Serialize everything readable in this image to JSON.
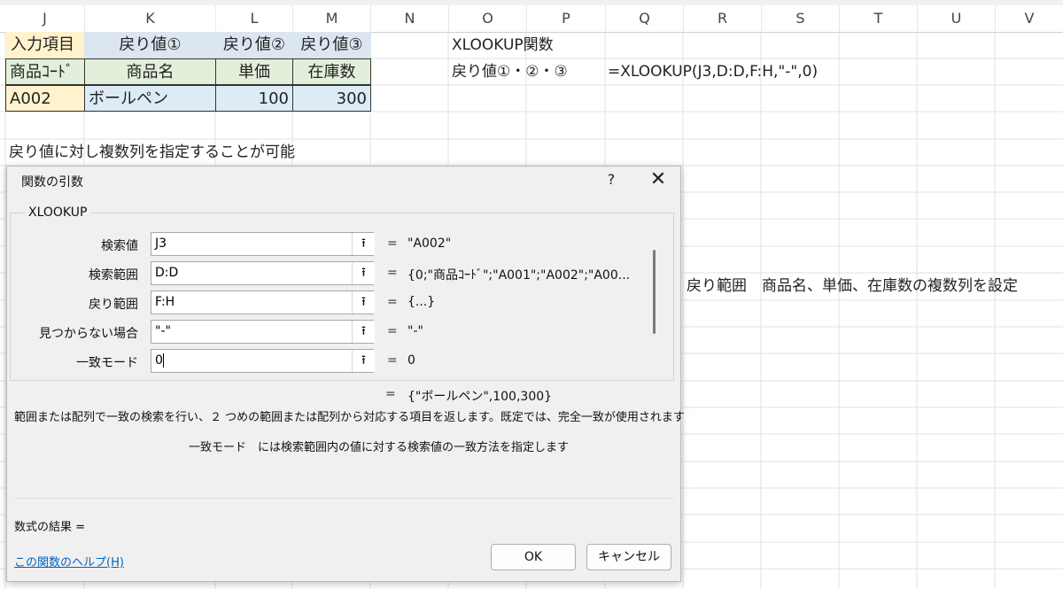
{
  "columns": [
    "J",
    "K",
    "L",
    "M",
    "N",
    "O",
    "P",
    "Q",
    "R",
    "S",
    "T",
    "U",
    "V"
  ],
  "table": {
    "row1": [
      "入力項目",
      "戻り値①",
      "戻り値②",
      "戻り値③"
    ],
    "row2": [
      "商品ｺｰﾄﾞ",
      "商品名",
      "単価",
      "在庫数"
    ],
    "row3": [
      "A002",
      "ボールペン",
      "100",
      "300"
    ]
  },
  "sheet_notes": {
    "xlookup_title": "XLOOKUP関数",
    "return_label": "戻り値①・②・③",
    "formula": "=XLOOKUP(J3,D:D,F:H,\"-\",0)",
    "multi_col_note": "戻り値に対し複数列を指定することが可能",
    "range_note": "戻り範囲　商品名、単価、在庫数の複数列を設定"
  },
  "dialog": {
    "title": "関数の引数",
    "help_glyph": "?",
    "close_glyph": "✕",
    "function_name": "XLOOKUP",
    "args": [
      {
        "label": "検索値",
        "value": "J3",
        "result": "\"A002\""
      },
      {
        "label": "検索範囲",
        "value": "D:D",
        "result": "{0;\"商品ｺｰﾄﾞ\";\"A001\";\"A002\";\"A00..."
      },
      {
        "label": "戻り範囲",
        "value": "F:H",
        "result": "{...}"
      },
      {
        "label": "見つからない場合",
        "value": "\"-\"",
        "result": "\"-\""
      },
      {
        "label": "一致モード",
        "value": "0",
        "result": "0"
      }
    ],
    "eq_sign": "=",
    "collapse_glyph": "⭱",
    "result_value": "{\"ボールペン\",100,300}",
    "description": "範囲または配列で一致の検索を行い、２ つめの範囲または配列から対応する項目を返します。既定では、完全一致が使用されます",
    "mode_hint": "一致モード　には検索範囲内の値に対する検索値の一致方法を指定します",
    "formula_result_label": "数式の結果 =",
    "help_link": "この関数のヘルプ(H)",
    "ok_label": "OK",
    "cancel_label": "キャンセル"
  },
  "colors": {
    "header_blue": "#dce6f1",
    "input_yellow": "#fff2cc",
    "row_green": "#e2efda",
    "data_blue": "#ddebf7",
    "link": "#0563c1"
  }
}
